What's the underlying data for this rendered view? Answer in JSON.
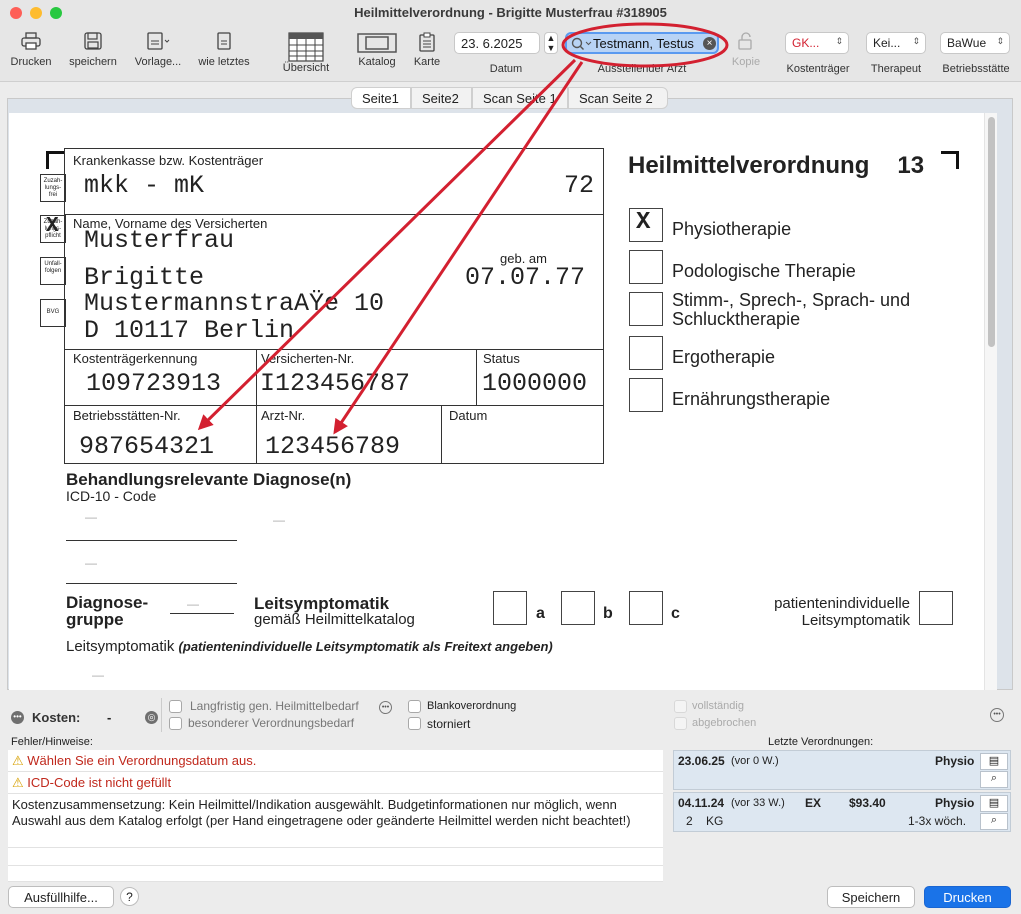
{
  "window": {
    "title": "Heilmittelverordnung -  Brigitte Musterfrau #318905"
  },
  "toolbar": {
    "print": "Drucken",
    "save": "speichern",
    "template": "Vorlage...",
    "like_last": "wie letztes",
    "overview": "Übersicht",
    "catalog": "Katalog",
    "card": "Karte",
    "date_value": "23. 6.2025",
    "date_label": "Datum",
    "doctor_value": "Testmann, Testus",
    "doctor_label": "Ausstellender Arzt",
    "copy": "Kopie",
    "payer_value": "GK...",
    "payer_label": "Kostenträger",
    "therapist_value": "Kei...",
    "therapist_label": "Therapeut",
    "site_value": "BaWue",
    "site_label": "Betriebsstätte"
  },
  "tabs": [
    "Seite1",
    "Seite2",
    "Scan Seite 1",
    "Scan Seite 2"
  ],
  "form": {
    "side_boxes": [
      "Zuzah-\nlungs-\nfrei",
      "Zuzah-\nlungs-\npflicht",
      "Unfall-\nfolgen",
      "BVG"
    ],
    "side_x": "X",
    "insurer_label": "Krankenkasse bzw. Kostenträger",
    "insurer_value": "mkk - mK",
    "insurer_code": "72",
    "name_label": "Name, Vorname des Versicherten",
    "name_last": "Musterfrau",
    "name_first": "Brigitte",
    "street": "MustermannstraAŸe 10",
    "city": "D 10117 Berlin",
    "dob_label": "geb. am",
    "dob": "07.07.77",
    "payer_id_label": "Kostenträgerkennung",
    "payer_id": "109723913",
    "insured_no_label": "Versicherten-Nr.",
    "insured_no": "I123456787",
    "status_label": "Status",
    "status": "1000000",
    "site_no_label": "Betriebsstätten-Nr.",
    "site_no": "987654321",
    "doctor_no_label": "Arzt-Nr.",
    "doctor_no": "123456789",
    "date_label": "Datum",
    "heading": "Heilmittelverordnung",
    "heading_no": "13",
    "therapy_x": "X",
    "therapies": [
      "Physiotherapie",
      "Podologische Therapie",
      "Stimm-, Sprech-, Sprach- und\nSchlucktherapie",
      "Ergotherapie",
      "Ernährungstherapie"
    ],
    "diag_heading": "Behandlungsrelevante Diagnose(n)",
    "icd_label": "ICD-10 - Code",
    "diag_group": "Diagnose-\ngruppe",
    "leitsym_title": "Leitsymptomatik",
    "leitsym_sub": "gemäß Heilmittelkatalog",
    "opt_a": "a",
    "opt_b": "b",
    "opt_c": "c",
    "patient_indiv": "patientenindividuelle\nLeitsymptomatik",
    "freitext_lead": "Leitsymptomatik",
    "freitext_note": "(patientenindividuelle Leitsymptomatik als Freitext angeben)",
    "dash": "—"
  },
  "options": {
    "cost_label": "Kosten:",
    "cost_value": "-",
    "longterm": "Langfristig gen. Heilmittelbedarf",
    "special": "besonderer Verordnungsbedarf",
    "blank": "Blankoverordnung",
    "cancelled": "storniert",
    "complete": "vollständig",
    "aborted": "abgebrochen"
  },
  "messages": {
    "label": "Fehler/Hinweise:",
    "warn1": "Wählen Sie ein Verordnungsdatum aus.",
    "warn2": "ICD-Code ist nicht gefüllt",
    "info": "Kostenzusammensetzung: Kein Heilmittel/Indikation ausgewählt. Budgetinformationen nur möglich, wenn Auswahl aus dem Katalog erfolgt (per Hand eingetragene oder geänderte Heilmittel werden nicht beachtet!)"
  },
  "recent": {
    "label": "Letzte Verordnungen:",
    "items": [
      {
        "date": "23.06.25",
        "ago": "(vor 0 W.)",
        "type": "Physio",
        "code": "",
        "price": "",
        "qty": "",
        "item": "",
        "freq": ""
      },
      {
        "date": "04.11.24",
        "ago": "(vor 33 W.)",
        "type": "Physio",
        "code": "EX",
        "price": "$93.40",
        "qty": "2",
        "item": "KG",
        "freq": "1-3x wöch."
      }
    ]
  },
  "footer": {
    "help": "Ausfüllhilfe...",
    "question": "?",
    "save": "Speichern",
    "print": "Drucken"
  },
  "colors": {
    "accent": "#1a73e8",
    "annotation_red": "#d32030",
    "warning_text": "#c0281c",
    "search_highlight": "#b8d3f5"
  }
}
